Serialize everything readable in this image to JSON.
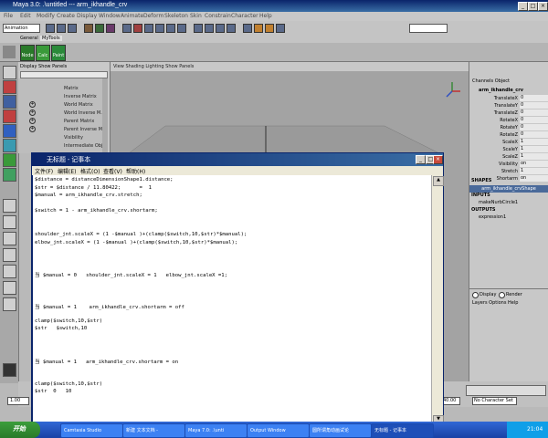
{
  "maya": {
    "title": "Maya 3.0: .\\untitled   ---   arm_ikhandle_crv",
    "menu": [
      "File",
      "Edit",
      "Modify",
      "Create",
      "Display",
      "Window",
      "Animate",
      "Deform",
      "Skeleton",
      "Skin",
      "Constrain",
      "Character",
      "Help"
    ],
    "mode_select": "Animation",
    "shelf_tabs": [
      "General",
      "MyTools"
    ],
    "shelf_buttons": [
      "Node",
      "Calc",
      "Paint"
    ],
    "outliner_menu": "Display  Show  Panels",
    "outliner_items": [
      "Matrix",
      "Inverse Matrix",
      "World Matrix",
      "World Inverse M.",
      "Parent Matrix",
      "Parent Inverse M.",
      "Visibility",
      "Intermediate Obj"
    ],
    "viewport_menu": "View  Shading  Lighting  Show  Panels",
    "channel_box": {
      "menu": "Channels  Object",
      "object": "arm_ikhandle_crv",
      "attributes": [
        {
          "name": "TranslateX",
          "value": "0"
        },
        {
          "name": "TranslateY",
          "value": "0"
        },
        {
          "name": "TranslateZ",
          "value": "0"
        },
        {
          "name": "RotateX",
          "value": "0"
        },
        {
          "name": "RotateY",
          "value": "0"
        },
        {
          "name": "RotateZ",
          "value": "0"
        },
        {
          "name": "ScaleX",
          "value": "1"
        },
        {
          "name": "ScaleY",
          "value": "1"
        },
        {
          "name": "ScaleZ",
          "value": "1"
        },
        {
          "name": "Visibility",
          "value": "on"
        },
        {
          "name": "Stretch",
          "value": "1"
        },
        {
          "name": "Shortarm",
          "value": "on"
        }
      ],
      "shapes_label": "SHAPES",
      "shape": "arm_ikhandle_crvShape",
      "inputs_label": "INPUTS",
      "input": "makeNurbCircle1",
      "outputs_label": "OUTPUTS",
      "output": "expression1",
      "display": "Display",
      "render": "Render",
      "layers_menu": "Layers  Options  Help"
    },
    "timeline": {
      "current": "1.00",
      "end": "40.00",
      "character_set": "No Character Set"
    }
  },
  "notepad": {
    "title": "无标题 - 记事本",
    "menu": [
      "文件(F)",
      "编辑(E)",
      "格式(O)",
      "查看(V)",
      "帮助(H)"
    ],
    "lines": [
      "$distance = distanceDimensionShape1.distance;",
      "$str = $distance / 11.80422;      =  1",
      "$manual = arm_ikhandle_crv.stretch;",
      "",
      "$switch = 1 - arm_ikhandle_crv.shortarm;",
      "",
      "",
      "shoulder_jnt.scaleX = (1 -$manual )+(clamp($switch,10,$str)*$manual);",
      "elbow_jnt.scaleX = (1 -$manual )+(clamp($switch,10,$str)*$manual);",
      "",
      "",
      "",
      "当 $manual = 0   shoulder_jnt.scaleX = 1   elbow_jnt.scaleX =1;",
      "",
      "",
      "",
      "当 $manual = 1    arm_ikhandle_crv.shortarm = off",
      "",
      "clamp($switch,10,$str)",
      "$str   $switch,10",
      "",
      "",
      "",
      "当 $manual = 1   arm_ikhandle_crv.shortarm = on",
      "",
      "",
      "clamp($switch,10,$str)",
      "$str  0   10"
    ]
  },
  "taskbar": {
    "start": "开始",
    "items": [
      "Camtasia Studio",
      "新建 文本文档 -",
      "Maya 7.0: .\\unti",
      "Output Window",
      "圆所谓角动画试论",
      "无标题 - 记事本"
    ],
    "clock": "21:04"
  }
}
